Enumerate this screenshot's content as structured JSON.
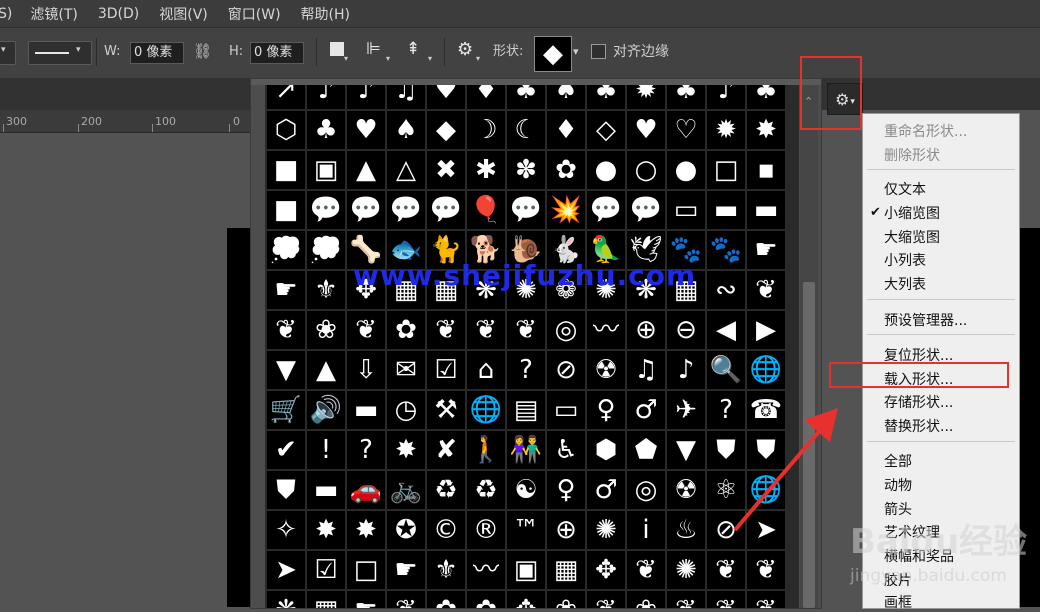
{
  "menubar": {
    "items": [
      "S)",
      "滤镜(T)",
      "3D(D)",
      "视图(V)",
      "窗口(W)",
      "帮助(H)"
    ]
  },
  "options": {
    "w_label": "W:",
    "w_value": "0 像素",
    "h_label": "H:",
    "h_value": "0 像素",
    "shape_label": "形状:",
    "align_edges_label": "对齐边缘"
  },
  "ruler": {
    "ticks": [
      "300",
      "200",
      "100",
      "0"
    ]
  },
  "watermark": "www.shejifuzhu.com",
  "brand_watermark": "Baidu经验",
  "brand_url": "jingyan.baidu.com",
  "menu": {
    "rename": "重命名形状...",
    "delete": "删除形状",
    "text_only": "仅文本",
    "small_thumb": "小缩览图",
    "large_thumb": "大缩览图",
    "small_list": "小列表",
    "large_list": "大列表",
    "preset_manager": "预设管理器...",
    "reset": "复位形状...",
    "load": "载入形状...",
    "save": "存储形状...",
    "replace": "替换形状...",
    "all": "全部",
    "animals": "动物",
    "arrows": "箭头",
    "art_texture": "艺术纹理",
    "banners": "横幅和奖品",
    "film": "胶片",
    "frames": "画框"
  },
  "colors": {
    "highlight": "#e8312f",
    "watermark": "#1f29e6"
  },
  "shape_grid": {
    "rows": [
      [
        "↗",
        "♪",
        "♪",
        "♫",
        "♥",
        "♦",
        "♣",
        "♠",
        "♣",
        "✹",
        "♣",
        "♪",
        "♣"
      ],
      [
        "⬡",
        "♣",
        "♥",
        "♠",
        "◆",
        "☽",
        "☾",
        "♦",
        "◇",
        "♥",
        "♡",
        "✹",
        "✸"
      ],
      [
        "■",
        "▣",
        "▲",
        "△",
        "✖",
        "✱",
        "✽",
        "✿",
        "●",
        "○",
        "●",
        "□",
        "▪"
      ],
      [
        "■",
        "💬",
        "💬",
        "💬",
        "💬",
        "🎈",
        "💬",
        "💥",
        "💬",
        "💬",
        "▭",
        "▬",
        "▬"
      ],
      [
        "💭",
        "💭",
        "🦴",
        "🐟",
        "🐈",
        "🐕",
        "🐌",
        "🐇",
        "🦜",
        "🕊",
        "🐾",
        "🐾",
        "☛"
      ],
      [
        "☛",
        "⚜",
        "✥",
        "▦",
        "▦",
        "❋",
        "✺",
        "❁",
        "✺",
        "❋",
        "▦",
        "∾",
        "❦"
      ],
      [
        "❦",
        "❀",
        "❦",
        "✿",
        "❦",
        "❦",
        "❦",
        "◎",
        "〰",
        "⊕",
        "⊖",
        "◀",
        "▶"
      ],
      [
        "▼",
        "▲",
        "⇩",
        "✉",
        "☑",
        "⌂",
        "?",
        "⊘",
        "☢",
        "♫",
        "♪",
        "🔍",
        "🌐"
      ],
      [
        "🛒",
        "🔊",
        "▬",
        "◷",
        "⚒",
        "🌐",
        "▤",
        "▭",
        "♀",
        "♂",
        "✈",
        "?",
        "☎"
      ],
      [
        "✔",
        "!",
        "?",
        "✸",
        "✘",
        "🚶",
        "👫",
        "♿",
        "⬢",
        "⬟",
        "▼",
        "⛊",
        "⛊"
      ],
      [
        "⛊",
        "▬",
        "🚗",
        "🚲",
        "♻",
        "♻",
        "☯",
        "♀",
        "♂",
        "◎",
        "☢",
        "⚛",
        "🌐"
      ],
      [
        "✧",
        "✸",
        "✸",
        "✪",
        "©",
        "®",
        "™",
        "⊕",
        "✺",
        "ⅰ",
        "♨",
        "⊘",
        "➤"
      ],
      [
        "➤",
        "☑",
        "□",
        "☛",
        "⚜",
        "〰",
        "▣",
        "▦",
        "✥",
        "❦",
        "✺",
        "❦",
        "❦"
      ],
      [
        "❋",
        "▦",
        "☛",
        "❦",
        "✿",
        "✿",
        "✥",
        "❀",
        "❦",
        "❀",
        "❦",
        "❦",
        "❦"
      ]
    ]
  }
}
